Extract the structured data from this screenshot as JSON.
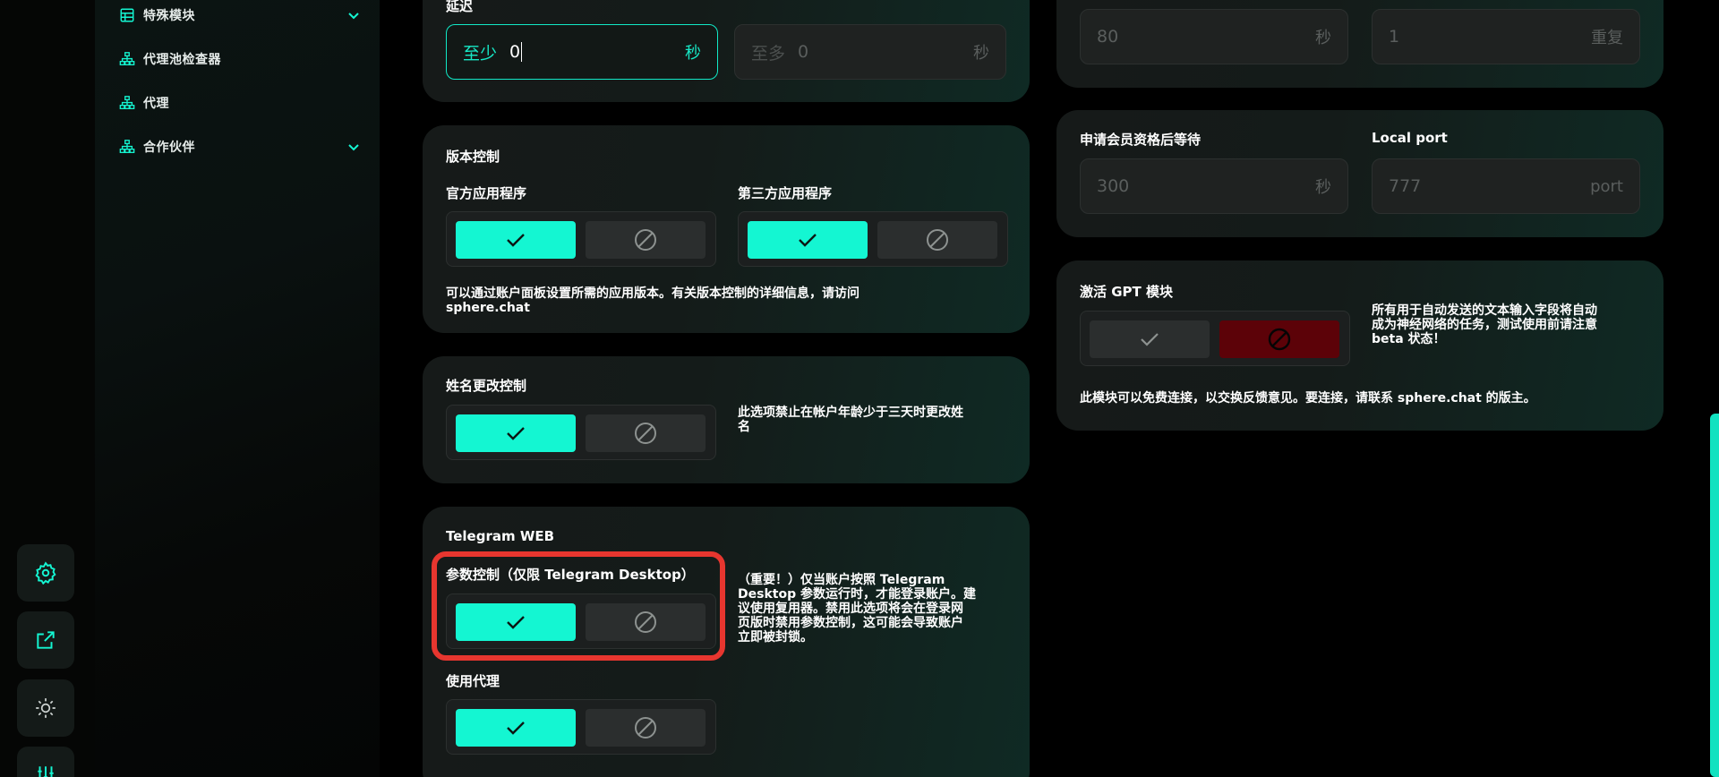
{
  "sidebar": {
    "items": [
      {
        "label": "特殊模块",
        "icon": "grid-icon",
        "expandable": true
      },
      {
        "label": "代理池检查器",
        "icon": "network-icon",
        "expandable": false
      },
      {
        "label": "代理",
        "icon": "network-icon",
        "expandable": false
      },
      {
        "label": "合作伙伴",
        "icon": "network-icon",
        "expandable": true
      }
    ]
  },
  "rail": {
    "buttons": [
      "settings-gear-icon",
      "external-link-icon",
      "theme-sun-moon-icon",
      "sliders-icon"
    ]
  },
  "delay": {
    "title": "延迟",
    "min_prefix": "至少",
    "min_value": "0",
    "min_unit": "秒",
    "max_prefix": "至多",
    "max_value": "0",
    "max_unit": "秒"
  },
  "version_control": {
    "title": "版本控制",
    "official_label": "官方应用程序",
    "third_party_label": "第三方应用程序",
    "desc_line1": "可以通过账户面板设置所需的应用版本。有关版本控制的详细信息，请访问",
    "desc_line2": "sphere.chat"
  },
  "name_change": {
    "title": "姓名更改控制",
    "desc_line1": "此选项禁止在帐户年龄少于三天时更改姓",
    "desc_line2": "名"
  },
  "telegram_web": {
    "title": "Telegram WEB",
    "param_label": "参数控制（仅限 Telegram Desktop）",
    "desc_lines": [
      "（重要！）仅当账户按照 Telegram",
      "Desktop 参数运行时，才能登录账户。建",
      "议使用复用器。禁用此选项将会在登录网",
      "页版时禁用参数控制，这可能会导致账户",
      "立即被封锁。"
    ],
    "proxy_label": "使用代理"
  },
  "right_top": {
    "field1_value": "80",
    "field1_unit": "秒",
    "field2_value": "1",
    "field2_unit": "重复"
  },
  "membership": {
    "wait_label": "申请会员资格后等待",
    "wait_value": "300",
    "wait_unit": "秒",
    "port_label": "Local port",
    "port_value": "777",
    "port_unit": "port"
  },
  "gpt": {
    "title": "激活 GPT 模块",
    "side_lines": [
      "所有用于自动发送的文本输入字段将自动",
      "成为神经网络的任务，测试使用前请注意",
      "beta 状态！"
    ],
    "footer": "此模块可以免费连接，以交换反馈意见。要连接，请联系 sphere.chat 的版主。"
  },
  "colors": {
    "accent": "#14f6d2",
    "danger": "#5c0208",
    "highlight": "#e7362f"
  }
}
